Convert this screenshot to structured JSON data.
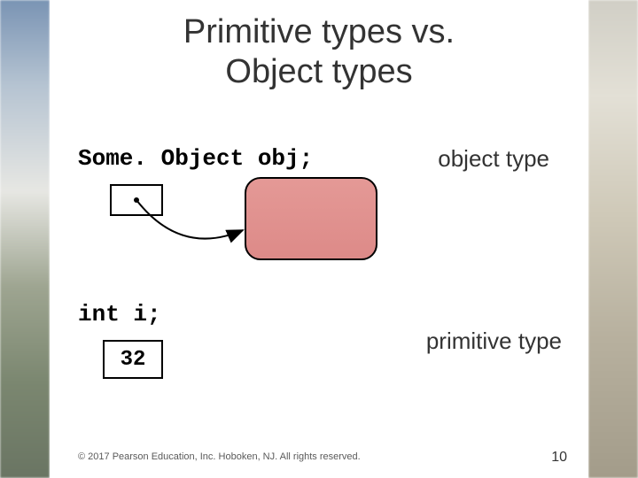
{
  "title_line1": "Primitive types vs.",
  "title_line2": "Object types",
  "code_object": "Some. Object obj;",
  "label_object": "object type",
  "code_int": "int i;",
  "label_primitive": "primitive type",
  "primitive_value": "32",
  "copyright": "© 2017 Pearson Education, Inc. Hoboken, NJ. All rights reserved.",
  "page_number": "10"
}
